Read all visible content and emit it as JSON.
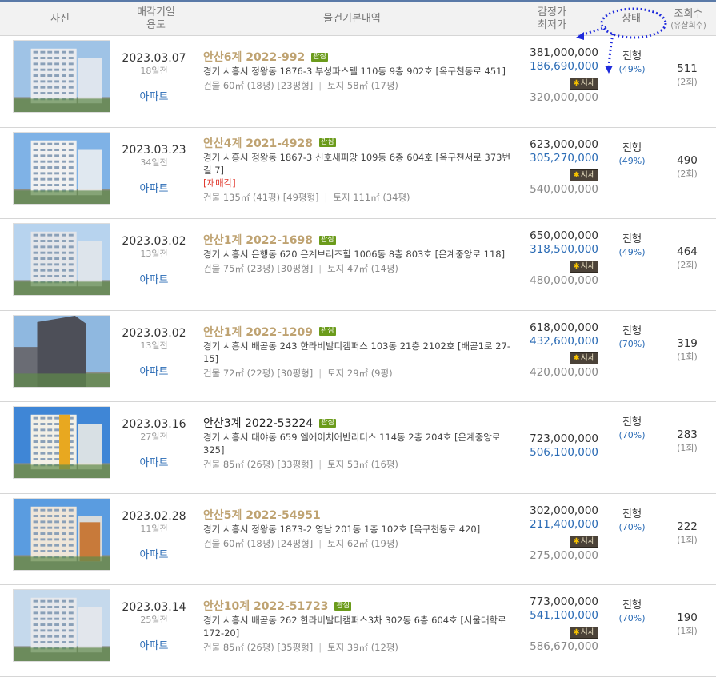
{
  "header": {
    "photo": "사진",
    "date": "매각기일",
    "use": "용도",
    "info": "물건기본내역",
    "appraisal": "감정가",
    "min_price": "최저가",
    "status": "상태",
    "views": "조회수",
    "fail_count": "(유찰회수)"
  },
  "rows": [
    {
      "date": "2023.03.07",
      "days": "18일전",
      "use": "아파트",
      "case": "안산6계 2022-992",
      "badge": "관심",
      "address": "경기 시흥시 정왕동 1876-3 부성파스텔 110동 9층 902호 [옥구천동로 451]",
      "resale": "",
      "spec_building": "건물 60㎡ (18평) [23평형]",
      "spec_land": "토지 58㎡ (17평)",
      "appraisal": "381,000,000",
      "min_price": "186,690,000",
      "market_label": "시세",
      "market_price": "320,000,000",
      "status": "진행",
      "percent": "(49%)",
      "views": "511",
      "fails": "(2회)"
    },
    {
      "date": "2023.03.23",
      "days": "34일전",
      "use": "아파트",
      "case": "안산4계 2021-4928",
      "badge": "관심",
      "address": "경기 시흥시 정왕동 1867-3 신호새피앙 109동 6층 604호 [옥구천서로 373번길 7]",
      "resale": "[재매각]",
      "spec_building": "건물 135㎡ (41평) [49평형]",
      "spec_land": "토지 111㎡ (34평)",
      "appraisal": "623,000,000",
      "min_price": "305,270,000",
      "market_label": "시세",
      "market_price": "540,000,000",
      "status": "진행",
      "percent": "(49%)",
      "views": "490",
      "fails": "(2회)"
    },
    {
      "date": "2023.03.02",
      "days": "13일전",
      "use": "아파트",
      "case": "안산1계 2022-1698",
      "badge": "관심",
      "address": "경기 시흥시 은행동 620 은계브리즈힐 1006동 8층 803호 [은계중앙로 118]",
      "resale": "",
      "spec_building": "건물 75㎡ (23평) [30평형]",
      "spec_land": "토지 47㎡ (14평)",
      "appraisal": "650,000,000",
      "min_price": "318,500,000",
      "market_label": "시세",
      "market_price": "480,000,000",
      "status": "진행",
      "percent": "(49%)",
      "views": "464",
      "fails": "(2회)"
    },
    {
      "date": "2023.03.02",
      "days": "13일전",
      "use": "아파트",
      "case": "안산1계 2022-1209",
      "badge": "관심",
      "address": "경기 시흥시 배곧동 243 한라비발디캠퍼스 103동 21층 2102호 [배곧1로 27-15]",
      "resale": "",
      "spec_building": "건물 72㎡ (22평) [30평형]",
      "spec_land": "토지 29㎡ (9평)",
      "appraisal": "618,000,000",
      "min_price": "432,600,000",
      "market_label": "시세",
      "market_price": "420,000,000",
      "status": "진행",
      "percent": "(70%)",
      "views": "319",
      "fails": "(1회)"
    },
    {
      "date": "2023.03.16",
      "days": "27일전",
      "use": "아파트",
      "case": "안산3계 2022-53224",
      "badge": "관심",
      "address": "경기 시흥시 대야동 659 엘에이치어반리더스 114동 2층 204호 [은계중앙로 325]",
      "resale": "",
      "spec_building": "건물 85㎡ (26평) [33평형]",
      "spec_land": "토지 53㎡ (16평)",
      "appraisal": "723,000,000",
      "min_price": "506,100,000",
      "market_label": "",
      "market_price": "",
      "status": "진행",
      "percent": "(70%)",
      "views": "283",
      "fails": "(1회)"
    },
    {
      "date": "2023.02.28",
      "days": "11일전",
      "use": "아파트",
      "case": "안산5계 2022-54951",
      "badge": "",
      "address": "경기 시흥시 정왕동 1873-2 영남 201동 1층 102호 [옥구천동로 420]",
      "resale": "",
      "spec_building": "건물 60㎡ (18평) [24평형]",
      "spec_land": "토지 62㎡ (19평)",
      "appraisal": "302,000,000",
      "min_price": "211,400,000",
      "market_label": "시세",
      "market_price": "275,000,000",
      "status": "진행",
      "percent": "(70%)",
      "views": "222",
      "fails": "(1회)"
    },
    {
      "date": "2023.03.14",
      "days": "25일전",
      "use": "아파트",
      "case": "안산10계 2022-51723",
      "badge": "관심",
      "address": "경기 시흥시 배곧동 262 한라비발디캠퍼스3차 302동 6층 604호 [서울대학로 172-20]",
      "resale": "",
      "spec_building": "건물 85㎡ (26평) [35평형]",
      "spec_land": "토지 39㎡ (12평)",
      "appraisal": "773,000,000",
      "min_price": "541,100,000",
      "market_label": "시세",
      "market_price": "586,670,000",
      "status": "진행",
      "percent": "(70%)",
      "views": "190",
      "fails": "(1회)"
    }
  ]
}
